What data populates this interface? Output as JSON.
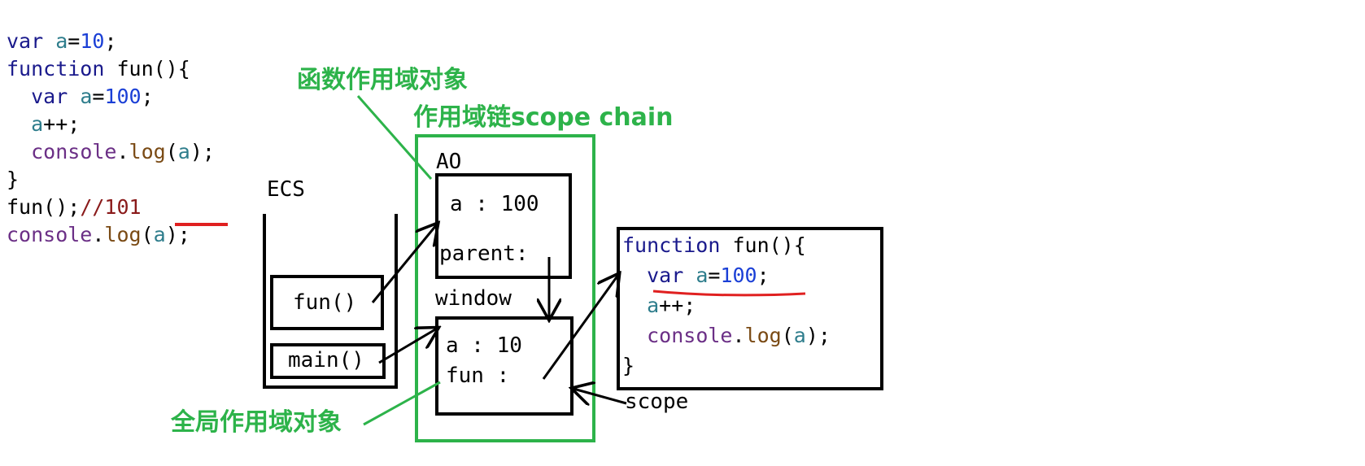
{
  "colors": {
    "keyword": "#1a1a8c",
    "variable": "#2e7d8c",
    "number": "#1a3fd6",
    "method": "#7a4a14",
    "console": "#6b2f86",
    "comment": "#8a1a1a",
    "plain": "#000000",
    "green": "#2db34a",
    "red": "#e02020"
  },
  "code": {
    "line1": {
      "kw": "var",
      "sp": " ",
      "var": "a",
      "eq": "=",
      "num": "10",
      "end": ";"
    },
    "line2": {
      "kw": "function",
      "rest": " fun(){"
    },
    "line3": {
      "indent": "  ",
      "kw": "var",
      "sp": " ",
      "var": "a",
      "eq": "=",
      "num": "100",
      "end": ";"
    },
    "line4": {
      "indent": "  ",
      "var": "a",
      "rest": "++;"
    },
    "line5": {
      "indent": "  ",
      "obj": "console",
      "dot": ".",
      "method": "log",
      "open": "(",
      "var": "a",
      "close": ");"
    },
    "line6": {
      "text": "}"
    },
    "line7": {
      "call": "fun();",
      "comment": "//101"
    },
    "line8": {
      "obj": "console",
      "dot": ".",
      "method": "log",
      "open": "(",
      "var": "a",
      "close": ");"
    }
  },
  "labels": {
    "ecs": "ECS",
    "fun_frame": "fun()",
    "main_frame": "main()",
    "ao": "AO",
    "window": "window",
    "scope": "scope",
    "function_scope_object": "函数作用域对象",
    "scope_chain": "作用域链scope chain",
    "global_scope_object": "全局作用域对象"
  },
  "ao_box": {
    "row1": "a : 100",
    "row2": "parent:"
  },
  "window_box": {
    "row1": "a : 10",
    "row2": "fun :"
  },
  "fun_box": {
    "line1": {
      "kw": "function",
      "rest": " fun(){"
    },
    "line2": {
      "indent": "  ",
      "kw": "var",
      "sp": " ",
      "var": "a",
      "eq": "=",
      "num": "100",
      "end": ";"
    },
    "line3": {
      "indent": "  ",
      "var": "a",
      "rest": "++;"
    },
    "line4": {
      "indent": "  ",
      "obj": "console",
      "dot": ".",
      "method": "log",
      "open": "(",
      "var": "a",
      "close": ");"
    },
    "line5": {
      "text": "}"
    }
  }
}
